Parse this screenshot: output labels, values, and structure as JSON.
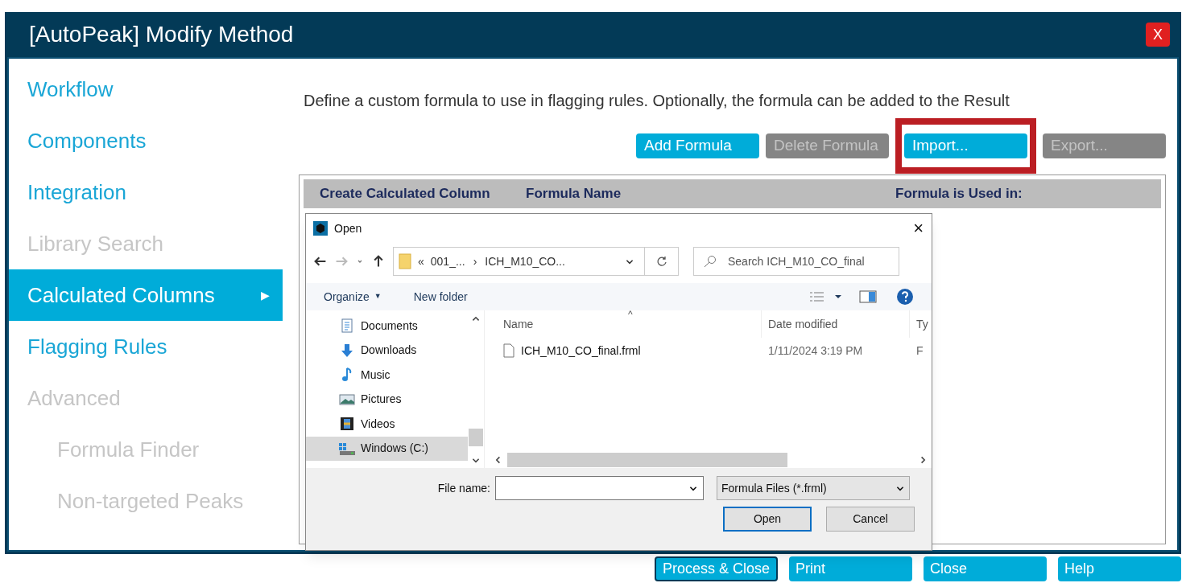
{
  "window": {
    "title": "[AutoPeak] Modify Method",
    "close": "X"
  },
  "sidebar": {
    "items": [
      {
        "label": "Workflow",
        "selected": false,
        "disabled": false
      },
      {
        "label": "Components",
        "selected": false,
        "disabled": false
      },
      {
        "label": "Integration",
        "selected": false,
        "disabled": false
      },
      {
        "label": "Library Search",
        "selected": false,
        "disabled": true
      },
      {
        "label": "Calculated Columns",
        "selected": true,
        "disabled": false,
        "arrow": "▶"
      },
      {
        "label": "Flagging Rules",
        "selected": false,
        "disabled": false
      },
      {
        "label": "Advanced",
        "selected": false,
        "disabled": true,
        "children": [
          {
            "label": "Formula Finder",
            "selected": false,
            "disabled": true
          },
          {
            "label": "Non-targeted Peaks",
            "selected": false,
            "disabled": true
          }
        ]
      }
    ]
  },
  "description": "Define a custom formula to use in flagging rules. Optionally, the formula can be added to the Result",
  "toolbar": [
    {
      "label": "Add Formula",
      "disabled": false,
      "highlighted": false
    },
    {
      "label": "Delete Formula",
      "disabled": true,
      "highlighted": false
    },
    {
      "label": "Import...",
      "disabled": false,
      "highlighted": true
    },
    {
      "label": "Export...",
      "disabled": true,
      "highlighted": false
    }
  ],
  "table": {
    "columns": [
      "Create Calculated Column",
      "Formula Name",
      "Formula is Used in:"
    ]
  },
  "open_dialog": {
    "title": "Open",
    "close": "×",
    "path": [
      "001_...",
      "ICH_M10_CO..."
    ],
    "path_prefix": "«",
    "path_sep": "›",
    "search": {
      "placeholder": "Search ICH_M10_CO_final"
    },
    "toolbar": [
      "Organize",
      "New folder"
    ],
    "tree": [
      {
        "label": "Documents",
        "kind": "document",
        "selected": false
      },
      {
        "label": "Downloads",
        "kind": "download",
        "selected": false
      },
      {
        "label": "Music",
        "kind": "music",
        "selected": false
      },
      {
        "label": "Pictures",
        "kind": "picture",
        "selected": false
      },
      {
        "label": "Videos",
        "kind": "video",
        "selected": false
      },
      {
        "label": "Windows (C:)",
        "kind": "drive",
        "selected": true
      }
    ],
    "organize_caret": "▼",
    "sort_caret": "^",
    "columns": [
      "Name",
      "Date modified",
      "Ty"
    ],
    "files": [
      {
        "name": "ICH_M10_CO_final.frml",
        "date": "1/11/2024 3:19 PM",
        "type": "F"
      }
    ],
    "file_name_label": "File name:",
    "file_type": "Formula Files (*.frml)",
    "buttons": [
      {
        "label": "Open",
        "default": true
      },
      {
        "label": "Cancel",
        "default": false
      }
    ]
  },
  "footer": [
    {
      "label": "Process & Close",
      "focused": true
    },
    {
      "label": "Print",
      "focused": false
    },
    {
      "label": "Close",
      "focused": false
    },
    {
      "label": "Help",
      "focused": false
    }
  ]
}
